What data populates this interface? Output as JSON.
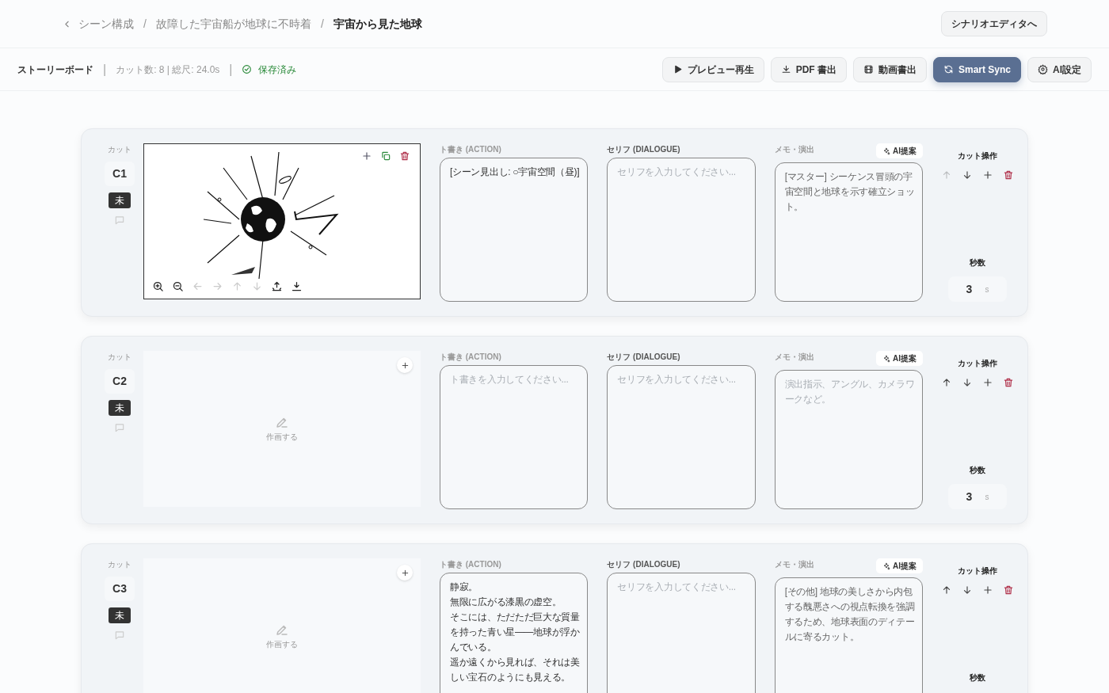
{
  "breadcrumb": {
    "back": "シーン構成",
    "separator": "/",
    "items": [
      {
        "label": "故障した宇宙船が地球に不時着",
        "current": false
      },
      {
        "label": "宇宙から見た地球",
        "current": true
      }
    ]
  },
  "header_button": "シナリオエディタへ",
  "toolbar": {
    "title": "ストーリーボード",
    "separator": "|",
    "stats": "カット数: 8 | 総尺: 24.0s",
    "saved": "保存済み",
    "buttons": [
      {
        "kind": "play",
        "label": "プレビュー再生",
        "primary": false
      },
      {
        "kind": "download",
        "label": "PDF 書出",
        "primary": false
      },
      {
        "kind": "film",
        "label": "動画書出",
        "primary": false
      },
      {
        "kind": "sync",
        "label": "Smart Sync",
        "primary": true
      },
      {
        "kind": "gear",
        "label": "AI設定",
        "primary": false
      }
    ]
  },
  "cuts": [
    {
      "cut_label": "カット",
      "number": "C1",
      "status": "未",
      "has_image": true,
      "action_label": "ト書き (ACTION)",
      "action": [
        "[シーン見出し: ○宇宙空間（昼)]"
      ],
      "dialogue_label": "セリフ (DIALOGUE)",
      "dialogue_placeholder": "セリフを入力してください...",
      "memo_label": "メモ・演出",
      "ai_button": "AI提案",
      "memo": "[マスター] シーケンス冒頭の宇宙空間と地球を示す確立ショット。",
      "ops_label": "カット操作",
      "up_disabled": true,
      "seconds_label": "秒数",
      "seconds": "3",
      "unit": "s"
    },
    {
      "cut_label": "カット",
      "number": "C2",
      "status": "未",
      "has_image": false,
      "draw_label": "作画する",
      "action_label": "ト書き (ACTION)",
      "action_placeholder": "ト書きを入力してください...",
      "dialogue_label": "セリフ (DIALOGUE)",
      "dialogue_placeholder": "セリフを入力してください...",
      "memo_label": "メモ・演出",
      "ai_button": "AI提案",
      "memo_placeholder": "演出指示、アングル、カメラワークなど。",
      "ops_label": "カット操作",
      "up_disabled": false,
      "seconds_label": "秒数",
      "seconds": "3",
      "unit": "s"
    },
    {
      "cut_label": "カット",
      "number": "C3",
      "status": "未",
      "has_image": false,
      "draw_label": "作画する",
      "action_label": "ト書き (ACTION)",
      "action": [
        "静寂。",
        "無限に広がる漆黒の虚空。",
        "そこには、ただただ巨大な質量を持った青い星——地球が浮かんでいる。",
        "遥か遠くから見れば、それは美しい宝石のようにも見える。"
      ],
      "dialogue_label": "セリフ (DIALOGUE)",
      "dialogue_placeholder": "セリフを入力してください...",
      "memo_label": "メモ・演出",
      "ai_button": "AI提案",
      "memo": "[その他] 地球の美しさから内包する醜悪さへの視点転換を強調するため、地球表面のディテールに寄るカット。",
      "ops_label": "カット操作",
      "up_disabled": false,
      "seconds_label": "秒数"
    }
  ]
}
